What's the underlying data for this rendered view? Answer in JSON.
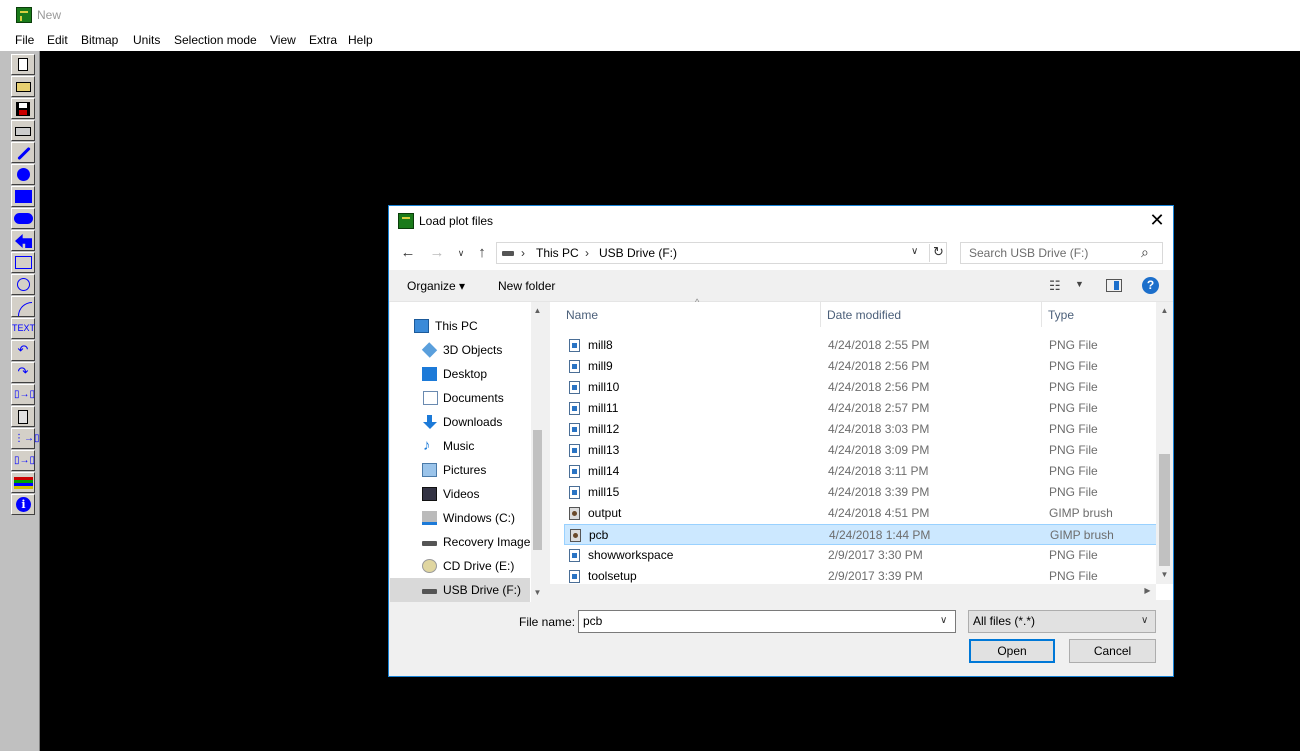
{
  "app": {
    "title": "New"
  },
  "menu": [
    "File",
    "Edit",
    "Bitmap",
    "Units",
    "Selection mode",
    "View",
    "Extra",
    "Help"
  ],
  "toolbar": {
    "text_tool_label": "TEXT"
  },
  "dialog": {
    "title": "Load plot files",
    "close_glyph": "✕",
    "address": {
      "crumbs": [
        "This PC",
        "USB Drive (F:)"
      ]
    },
    "search_placeholder": "Search USB Drive (F:)",
    "organize_label": "Organize ▾",
    "new_folder_label": "New folder",
    "help_glyph": "?",
    "nav_items": [
      "This PC",
      "3D Objects",
      "Desktop",
      "Documents",
      "Downloads",
      "Music",
      "Pictures",
      "Videos",
      "Windows (C:)",
      "Recovery Image",
      "CD Drive (E:)",
      "USB Drive (F:)"
    ],
    "columns": {
      "name": "Name",
      "date": "Date modified",
      "type": "Type"
    },
    "files": [
      {
        "name": "mill8",
        "date": "4/24/2018 2:55 PM",
        "type": "PNG File"
      },
      {
        "name": "mill9",
        "date": "4/24/2018 2:56 PM",
        "type": "PNG File"
      },
      {
        "name": "mill10",
        "date": "4/24/2018 2:56 PM",
        "type": "PNG File"
      },
      {
        "name": "mill11",
        "date": "4/24/2018 2:57 PM",
        "type": "PNG File"
      },
      {
        "name": "mill12",
        "date": "4/24/2018 3:03 PM",
        "type": "PNG File"
      },
      {
        "name": "mill13",
        "date": "4/24/2018 3:09 PM",
        "type": "PNG File"
      },
      {
        "name": "mill14",
        "date": "4/24/2018 3:11 PM",
        "type": "PNG File"
      },
      {
        "name": "mill15",
        "date": "4/24/2018 3:39 PM",
        "type": "PNG File"
      },
      {
        "name": "output",
        "date": "4/24/2018 4:51 PM",
        "type": "GIMP brush"
      },
      {
        "name": "pcb",
        "date": "4/24/2018 1:44 PM",
        "type": "GIMP brush"
      },
      {
        "name": "showworkspace",
        "date": "2/9/2017 3:30 PM",
        "type": "PNG File"
      },
      {
        "name": "toolsetup",
        "date": "2/9/2017 3:39 PM",
        "type": "PNG File"
      }
    ],
    "file_name_label": "File name:",
    "file_name_value": "pcb",
    "file_filter": "All files (*.*)",
    "open_label": "Open",
    "cancel_label": "Cancel"
  }
}
